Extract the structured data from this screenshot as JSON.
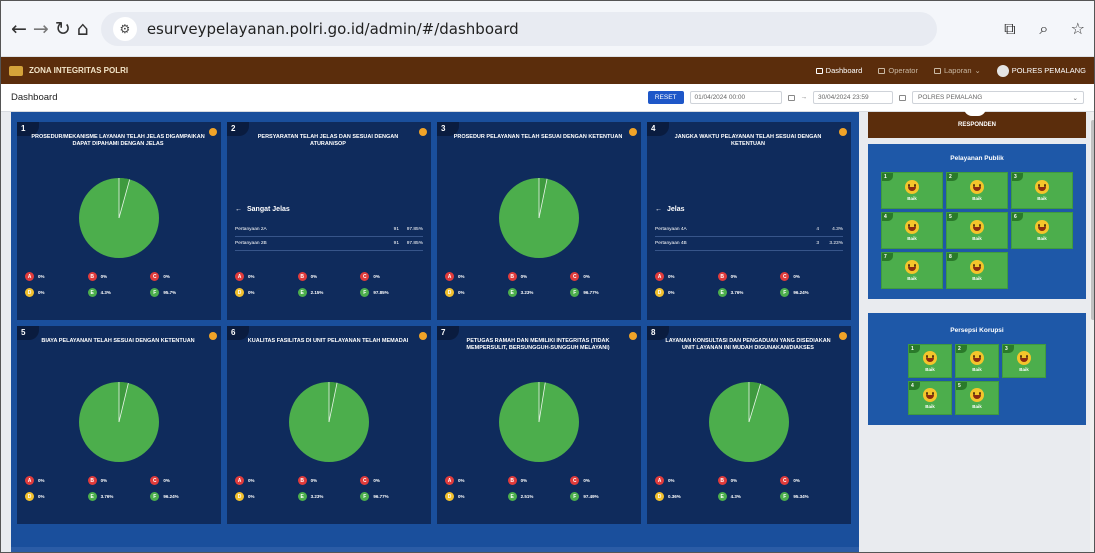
{
  "browser": {
    "url": "esurveypelayanan.polri.go.id/admin/#/dashboard"
  },
  "appbar": {
    "brand": "ZONA INTEGRITAS POLRI",
    "nav": [
      {
        "label": "Dashboard"
      },
      {
        "label": "Operator"
      },
      {
        "label": "Laporan"
      },
      {
        "label": "POLRES PEMALANG"
      }
    ]
  },
  "subheader": {
    "title": "Dashboard",
    "reset": "RESET",
    "start": "01/04/2024 00:00",
    "arrow": "→",
    "end": "30/04/2024 23:59",
    "unit": "POLRES PEMALANG"
  },
  "colors": {
    "A": "#e03b3b",
    "B": "#e03b3b",
    "C": "#e03b3b",
    "D": "#f2c02d",
    "E": "#4cae4c",
    "F": "#4cae4c",
    "pie": "#4cae4c"
  },
  "questions": [
    {
      "num": "1",
      "title": "PROSEDUR/MEKANISME LAYANAN TELAH JELAS DIGAMPAIKAN DAPAT DIPAHAMI DENGAN JELAS",
      "legend": [
        "0%",
        "0%",
        "0%",
        "0%",
        "4.3%",
        "95.7%"
      ],
      "pie_share_f": 95.7
    },
    {
      "num": "2",
      "title": "PERSYARATAN TELAH JELAS DAN SESUAI DENGAN ATURAN/SOP",
      "detail": {
        "head": "Sangat Jelas",
        "rows": [
          [
            "Pertanyaan 2A",
            "91",
            "97.85%"
          ],
          [
            "Pertanyaan 2B",
            "91",
            "97.85%"
          ]
        ]
      },
      "legend": [
        "0%",
        "0%",
        "0%",
        "0%",
        "2.15%",
        "97.85%"
      ]
    },
    {
      "num": "3",
      "title": "PROSEDUR PELAYANAN TELAH SESUAI DENGAN KETENTUAN",
      "legend": [
        "0%",
        "0%",
        "0%",
        "0%",
        "3.23%",
        "96.77%"
      ],
      "pie_share_f": 96.77
    },
    {
      "num": "4",
      "title": "JANGKA WAKTU PELAYANAN TELAH SESUAI DENGAN KETENTUAN",
      "detail": {
        "head": "Jelas",
        "rows": [
          [
            "Pertanyaan 4A",
            "4",
            "4.3%"
          ],
          [
            "Pertanyaan 4B",
            "3",
            "3.23%"
          ]
        ]
      },
      "legend": [
        "0%",
        "0%",
        "0%",
        "0%",
        "3.76%",
        "96.24%"
      ]
    },
    {
      "num": "5",
      "title": "BIAYA PELAYANAN TELAH SESUAI DENGAN KETENTUAN",
      "legend": [
        "0%",
        "0%",
        "0%",
        "0%",
        "3.76%",
        "96.24%"
      ],
      "pie_share_f": 96.24
    },
    {
      "num": "6",
      "title": "KUALITAS FASILITAS DI UNIT PELAYANAN TELAH MEMADAI",
      "legend": [
        "0%",
        "0%",
        "0%",
        "0%",
        "3.23%",
        "96.77%"
      ],
      "pie_share_f": 96.77
    },
    {
      "num": "7",
      "title": "PETUGAS RAMAH DAN MEMILIKI INTEGRITAS (TIDAK MEMPERSULIT, BERSUNGGUH-SUNGGUH MELAYANI)",
      "legend": [
        "0%",
        "0%",
        "0%",
        "0%",
        "2.51%",
        "97.49%"
      ],
      "pie_share_f": 97.49
    },
    {
      "num": "8",
      "title": "LAYANAN KONSULTASI DAN PENGADUAN YANG DISEDIAKAN UNIT LAYANAN INI MUDAH DIGUNAKAN/DIAKSES",
      "legend": [
        "0%",
        "0%",
        "0%",
        "0.36%",
        "4.3%",
        "95.34%"
      ],
      "pie_share_f": 95.34
    }
  ],
  "legend_letters": [
    "A",
    "B",
    "C",
    "D",
    "E",
    "F"
  ],
  "sidebar": {
    "responden": "RESPONDEN",
    "pelayanan_title": "Pelayanan Publik",
    "pelayanan": [
      {
        "num": "1",
        "label": "Baik"
      },
      {
        "num": "2",
        "label": "Baik"
      },
      {
        "num": "3",
        "label": "Baik"
      },
      {
        "num": "4",
        "label": "Baik"
      },
      {
        "num": "5",
        "label": "Baik"
      },
      {
        "num": "6",
        "label": "Baik"
      },
      {
        "num": "7",
        "label": "Baik"
      },
      {
        "num": "8",
        "label": "Baik"
      }
    ],
    "korupsi_title": "Persepsi Korupsi",
    "korupsi": [
      {
        "num": "1",
        "label": "Baik"
      },
      {
        "num": "2",
        "label": "Baik"
      },
      {
        "num": "3",
        "label": "Baik"
      },
      {
        "num": "4",
        "label": "Baik"
      },
      {
        "num": "5",
        "label": "Baik"
      }
    ]
  }
}
